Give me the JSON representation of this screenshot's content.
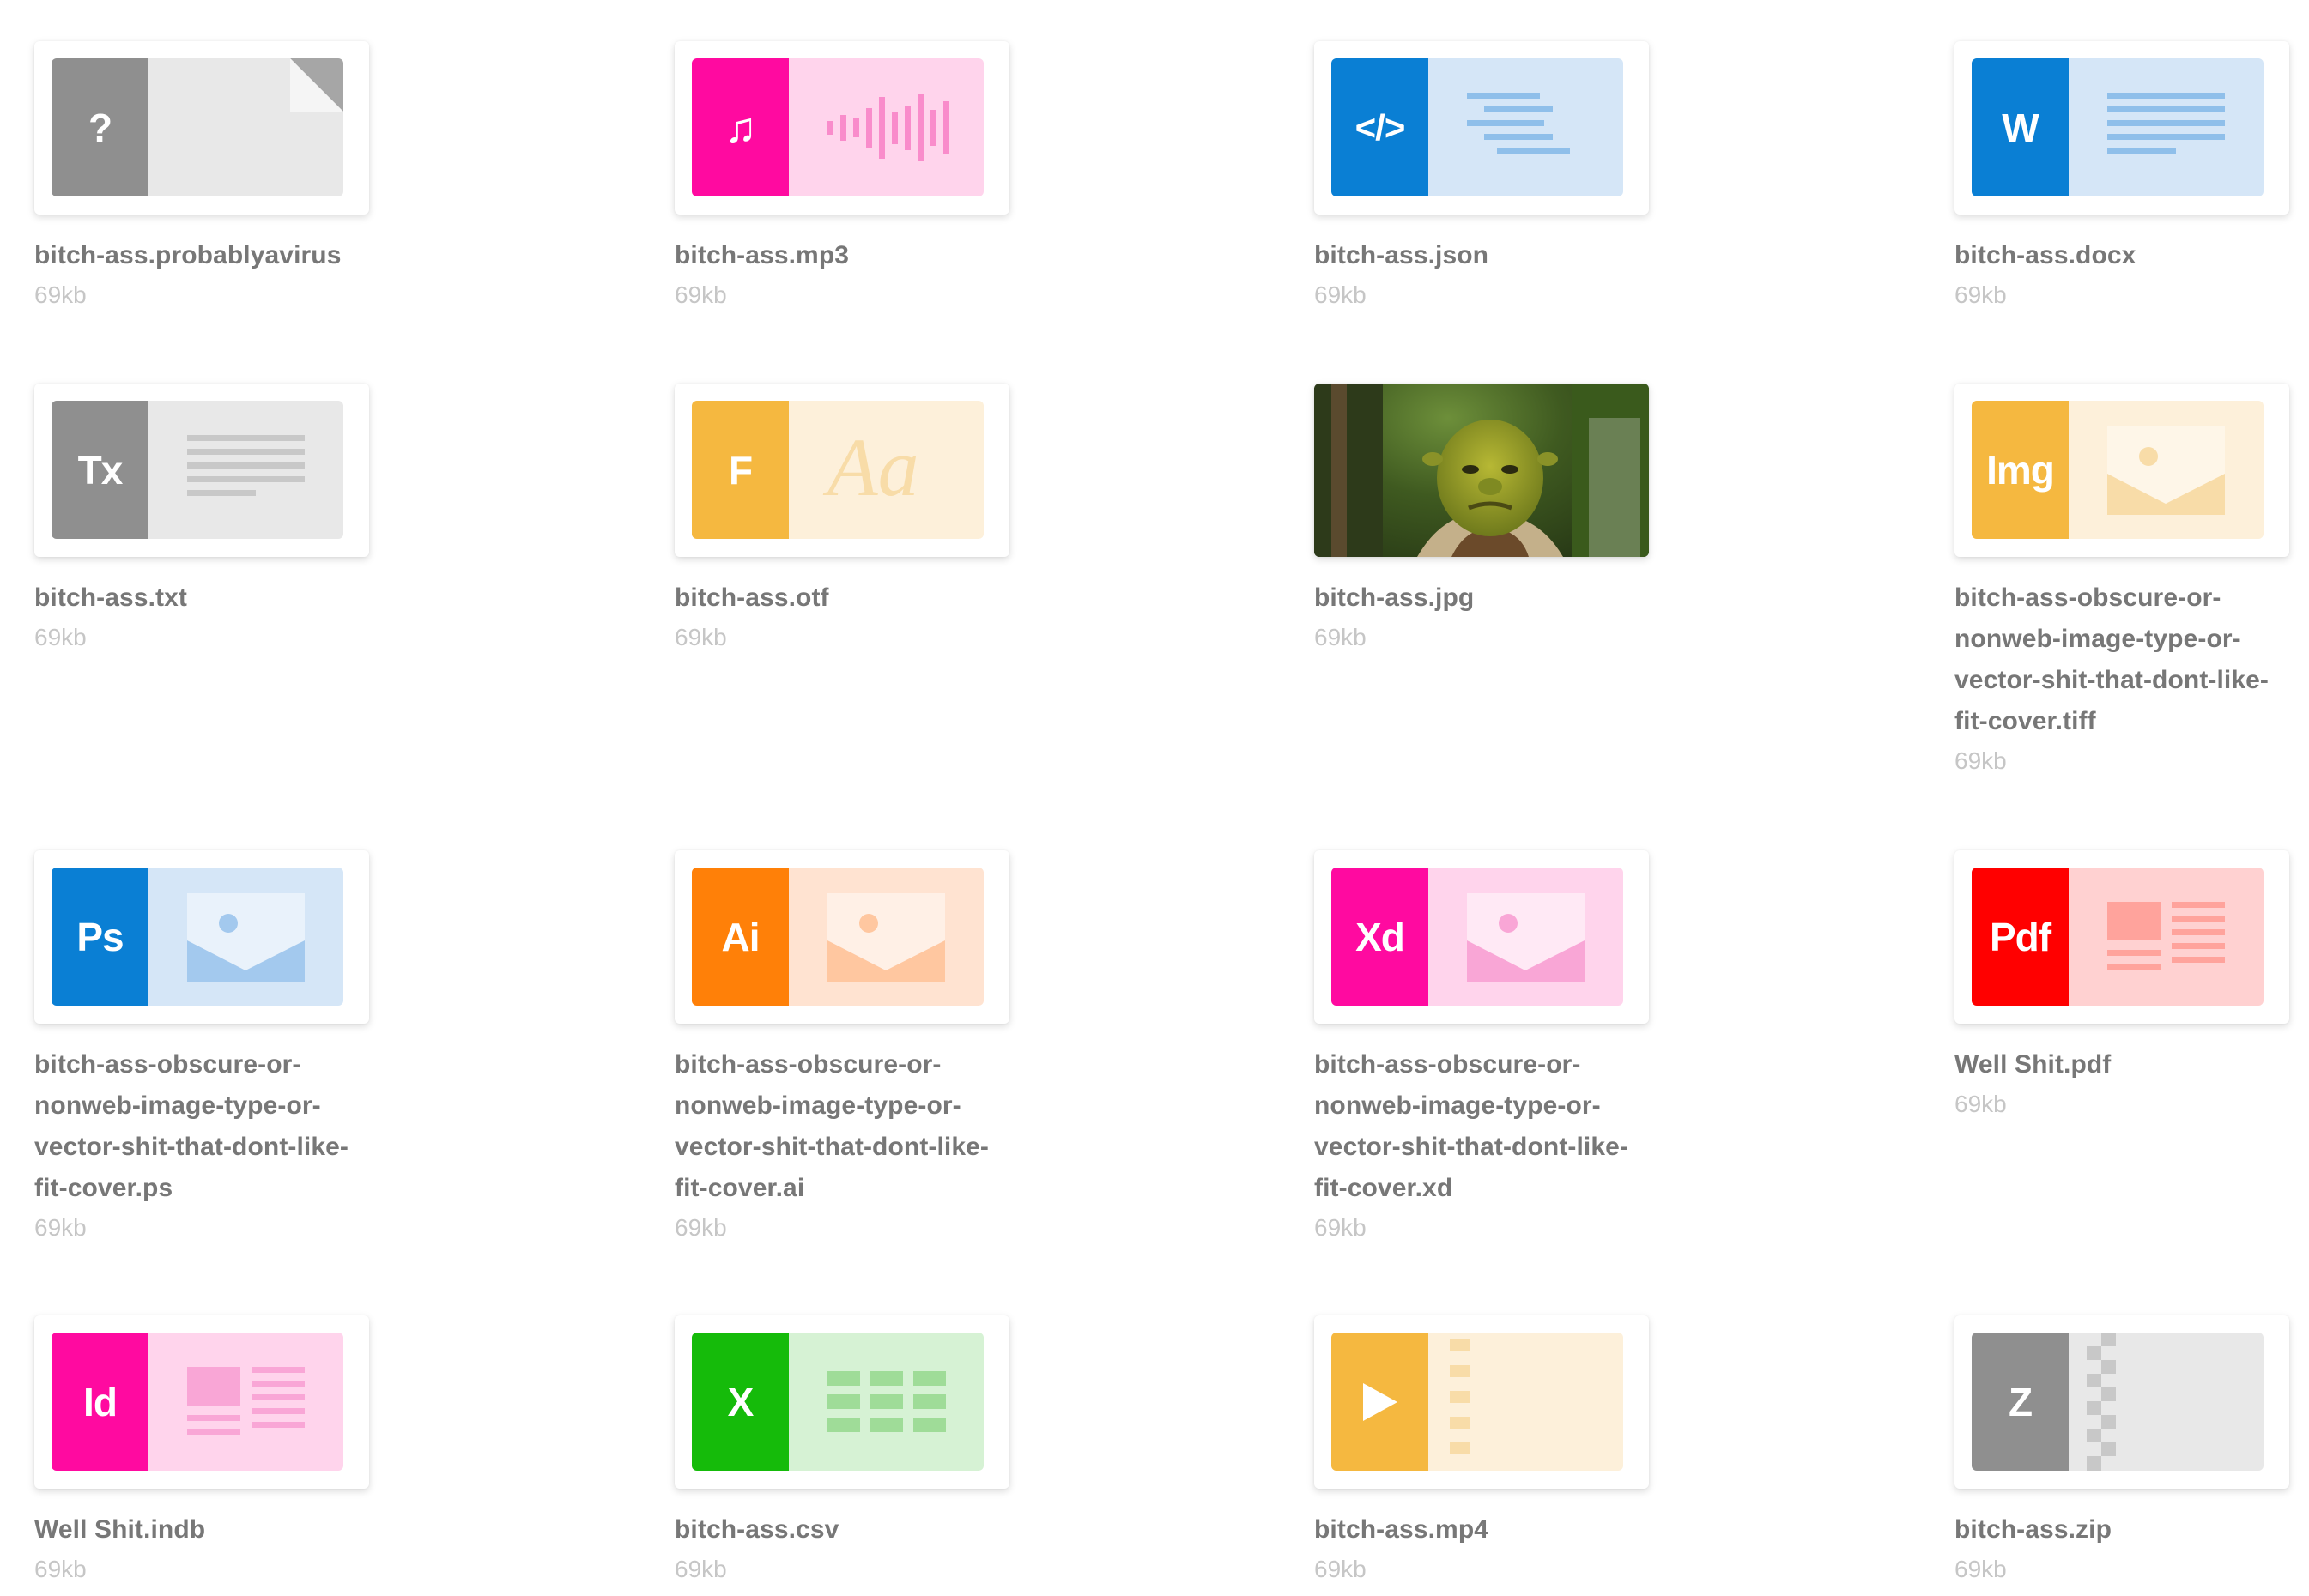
{
  "colors": {
    "gray_strip": "#8f8f8f",
    "gray_bg": "#e8e8e8",
    "pink_strip": "#ff0aa0",
    "pink_bg": "#ffd4ec",
    "blue_strip": "#0a7fd4",
    "blue_bg": "#d5e6f7",
    "yellow_strip": "#f5b840",
    "yellow_bg": "#fdf0da",
    "orange_strip": "#ff8008",
    "orange_bg": "#ffe3d1",
    "red_strip": "#ff0000",
    "red_bg": "#ffd1d1",
    "green_strip": "#15bb0a",
    "green_bg": "#d6f2d4",
    "name_text": "#777777",
    "size_text": "#c6c6c6"
  },
  "files": [
    {
      "name": "bitch-ass.probablyavirus",
      "size": "69kb",
      "label": "?",
      "icon": "unknown-file-icon"
    },
    {
      "name": "bitch-ass.mp3",
      "size": "69kb",
      "label": "♫",
      "icon": "audio-icon"
    },
    {
      "name": "bitch-ass.json",
      "size": "69kb",
      "label": "</>",
      "icon": "code-icon"
    },
    {
      "name": "bitch-ass.docx",
      "size": "69kb",
      "label": "W",
      "icon": "word-document-icon"
    },
    {
      "name": "bitch-ass.txt",
      "size": "69kb",
      "label": "Tx",
      "icon": "text-document-icon"
    },
    {
      "name": "bitch-ass.otf",
      "size": "69kb",
      "label": "F",
      "preview_text": "Aa",
      "icon": "font-icon"
    },
    {
      "name": "bitch-ass.jpg",
      "size": "69kb",
      "icon": "photo-thumbnail"
    },
    {
      "name": "bitch-ass-obscure-or-nonweb-image-type-or-vector-shit-that-dont-like-fit-cover.tiff",
      "size": "69kb",
      "label": "Img",
      "icon": "image-icon"
    },
    {
      "name": "bitch-ass-obscure-or-nonweb-image-type-or-vector-shit-that-dont-like-fit-cover.ps",
      "size": "69kb",
      "label": "Ps",
      "icon": "photoshop-icon"
    },
    {
      "name": "bitch-ass-obscure-or-nonweb-image-type-or-vector-shit-that-dont-like-fit-cover.ai",
      "size": "69kb",
      "label": "Ai",
      "icon": "illustrator-icon"
    },
    {
      "name": "bitch-ass-obscure-or-nonweb-image-type-or-vector-shit-that-dont-like-fit-cover.xd",
      "size": "69kb",
      "label": "Xd",
      "icon": "xd-icon"
    },
    {
      "name": "Well Shit.pdf",
      "size": "69kb",
      "label": "Pdf",
      "icon": "pdf-icon"
    },
    {
      "name": "Well Shit.indb",
      "size": "69kb",
      "label": "Id",
      "icon": "indesign-icon"
    },
    {
      "name": "bitch-ass.csv",
      "size": "69kb",
      "label": "X",
      "icon": "spreadsheet-icon"
    },
    {
      "name": "bitch-ass.mp4",
      "size": "69kb",
      "label": "▶",
      "icon": "video-icon"
    },
    {
      "name": "bitch-ass.zip",
      "size": "69kb",
      "label": "Z",
      "icon": "archive-icon"
    }
  ]
}
